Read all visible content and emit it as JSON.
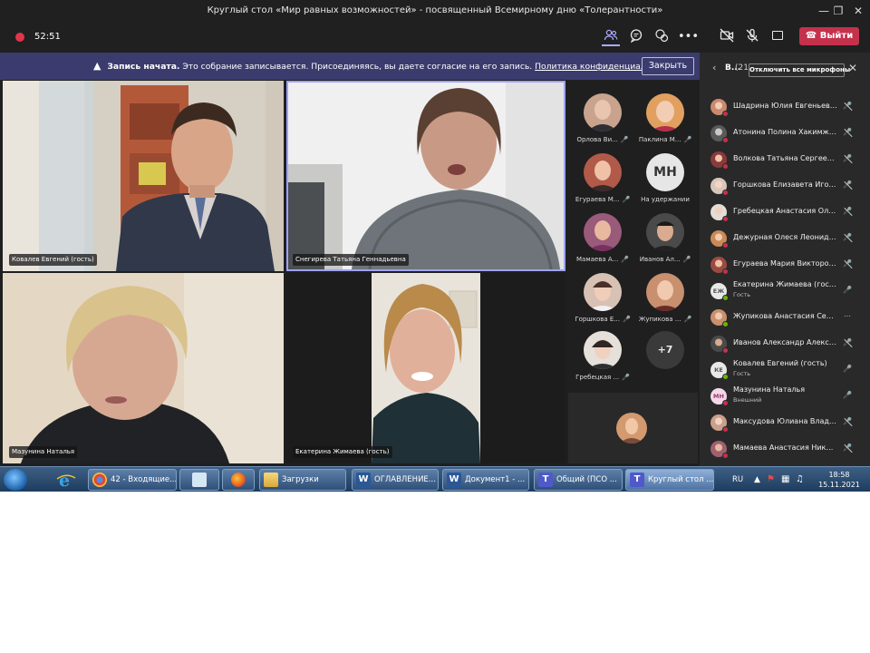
{
  "window": {
    "title": "Круглый стол «Мир равных возможностей» - посвященный Всемирному дню «Толерантности»"
  },
  "toolbar": {
    "timer": "52:51",
    "leave_label": "Выйти"
  },
  "banner": {
    "title": "Запись начата.",
    "message": "Это собрание записывается. Присоединяясь, вы даете согласие на его запись.",
    "link": "Политика конфиденциальности",
    "close_label": "Закрыть"
  },
  "videos": [
    {
      "name": "Ковалев Евгений (гость)"
    },
    {
      "name": "Снегирева Татьяна Геннадьевна"
    },
    {
      "name": "Мазунина Наталья"
    },
    {
      "name": "Екатерина Жимаева (гость)"
    }
  ],
  "gallery": {
    "items": [
      {
        "name": "Орлова Ви...",
        "color": "#c9a38e"
      },
      {
        "name": "Паклина М...",
        "color": "#e1a060"
      },
      {
        "name": "Егураева М...",
        "color": "#b25a4a"
      },
      {
        "name": "На удержании",
        "initials": "МН"
      },
      {
        "name": "Мамаева А...",
        "color": "#9a5a7a"
      },
      {
        "name": "Иванов Ал...",
        "color": "#4a4a4a"
      },
      {
        "name": "Горшкова Е...",
        "color": "#d7c1b5"
      },
      {
        "name": "Жупикова ...",
        "color": "#c8906e"
      },
      {
        "name": "Гребецкая ...",
        "color": "#e6e0da"
      }
    ],
    "more": "+7"
  },
  "panel": {
    "title": "В...",
    "count": "(21)",
    "mute_all_label": "Отключить все микрофоны",
    "participants": [
      {
        "name": "Шадрина Юлия Евгеньевна",
        "sub": "",
        "color": "#c98a6e",
        "mic": "muted"
      },
      {
        "name": "Атонина Полина Хакимжан...",
        "sub": "",
        "color": "#5a5a5a",
        "mic": "muted"
      },
      {
        "name": "Волкова Татьяна Сергеевна",
        "sub": "",
        "color": "#8a3a3a",
        "mic": "muted"
      },
      {
        "name": "Горшкова Елизавета Игорев...",
        "sub": "",
        "color": "#d9c6bb",
        "mic": "muted"
      },
      {
        "name": "Гребецкая Анастасия Олего...",
        "sub": "",
        "color": "#e4ddd6",
        "mic": "muted"
      },
      {
        "name": "Дежурная Олеся Леонидовна",
        "sub": "",
        "color": "#c98a58",
        "mic": "muted"
      },
      {
        "name": "Егураева Мария Викторовна",
        "sub": "",
        "color": "#9a4a42",
        "mic": "muted"
      },
      {
        "name": "Екатерина Жимаева (гость)",
        "sub": "Гость",
        "initials": "ЕЖ",
        "mic": "on"
      },
      {
        "name": "Жупикова Анастасия Серге...",
        "sub": "",
        "color": "#c8906e",
        "mic": "more"
      },
      {
        "name": "Иванов Александр Александ...",
        "sub": "",
        "color": "#4a4a4a",
        "mic": "muted"
      },
      {
        "name": "Ковалев Евгений (гость)",
        "sub": "Гость",
        "initials": "КЕ",
        "mic": "on"
      },
      {
        "name": "Мазунина Наталья",
        "sub": "Внешний",
        "initials": "МН",
        "mic": "on"
      },
      {
        "name": "Максудова Юлиана Владим...",
        "sub": "",
        "color": "#c9a08a",
        "mic": "muted"
      },
      {
        "name": "Мамаева Анастасия Никола...",
        "sub": "",
        "color": "#a06070",
        "mic": "muted"
      }
    ]
  },
  "taskbar": {
    "buttons": [
      {
        "label": "42 - Входящие...",
        "icon": "chrome-icon"
      },
      {
        "label": "",
        "icon": "notes-icon"
      },
      {
        "label": "",
        "icon": "firefox-icon"
      },
      {
        "label": "Загрузки",
        "icon": "folder-icon"
      },
      {
        "label": "ОГЛАВЛЕНИЕ...",
        "icon": "word-icon"
      },
      {
        "label": "Документ1 - ...",
        "icon": "word-icon"
      },
      {
        "label": "Общий (ПСО ...",
        "icon": "teams-icon"
      },
      {
        "label": "Круглый стол ...",
        "icon": "teams-icon"
      }
    ],
    "lang": "RU",
    "time": "18:58",
    "date": "15.11.2021"
  }
}
